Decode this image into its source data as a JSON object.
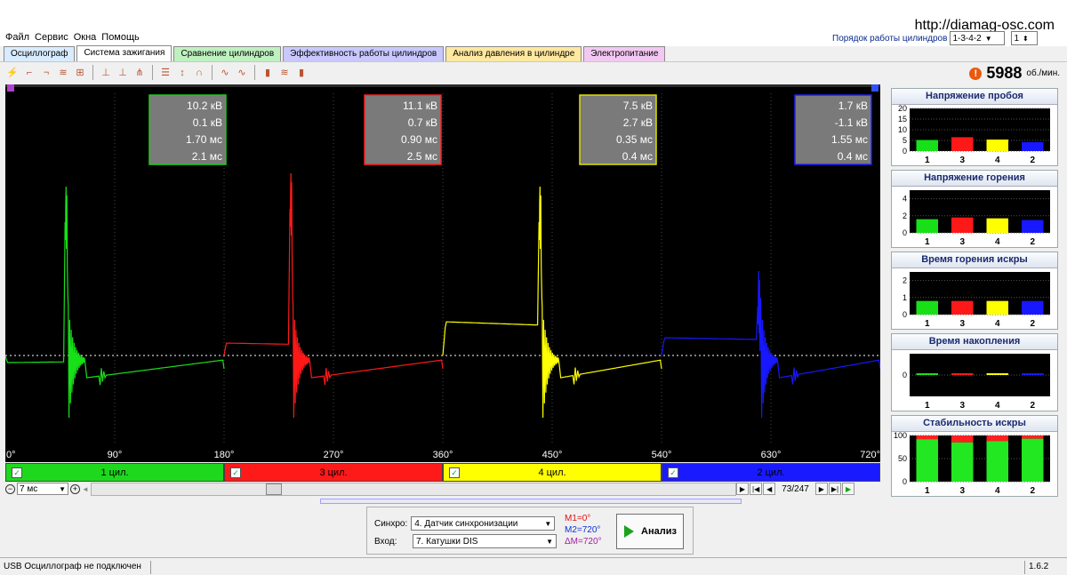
{
  "app": {
    "url": "http://diamag-osc.com",
    "menu": [
      "Файл",
      "Сервис",
      "Окна",
      "Помощь"
    ],
    "firing_order_label": "Порядок работы цилиндров",
    "firing_order_value": "1-3-4-2",
    "firing_order_index": "1"
  },
  "tabs": [
    {
      "label": "Осциллограф",
      "color": "#d8ecff",
      "active": false
    },
    {
      "label": "Система зажигания",
      "color": "#ffffff",
      "active": true
    },
    {
      "label": "Сравнение цилиндров",
      "color": "#bff0c0",
      "active": false
    },
    {
      "label": "Эффективность работы цилиндров",
      "color": "#c8c8ff",
      "active": false
    },
    {
      "label": "Анализ давления в цилиндре",
      "color": "#ffe8a0",
      "active": false
    },
    {
      "label": "Электропитание",
      "color": "#f2c8f2",
      "active": false
    }
  ],
  "toolbar": {
    "icons": [
      "spark-icon",
      "rise-icon",
      "fall-icon",
      "coil-icon",
      "counter-icon",
      "|",
      "pulse-icon",
      "multi-pulse-icon",
      "scatter-icon",
      "|",
      "lines-icon",
      "sync-icon",
      "loop-icon",
      "|",
      "wave-icon",
      "wave-split-icon",
      "|",
      "histogram-icon",
      "stack-icon",
      "bars-icon"
    ],
    "rpm_value": "5988",
    "rpm_unit": "об./мин."
  },
  "chart_data": {
    "type": "line",
    "xlabel": "",
    "ylabel": "",
    "x_ticks": [
      "0°",
      "90°",
      "180°",
      "270°",
      "360°",
      "450°",
      "540°",
      "630°",
      "720°"
    ],
    "xlim": [
      0,
      720
    ],
    "series": [
      {
        "name": "1 цил.",
        "color": "#18e018",
        "x_range": [
          0,
          180
        ],
        "spike_deg": 50
      },
      {
        "name": "3 цил.",
        "color": "#ff1818",
        "x_range": [
          180,
          360
        ],
        "spike_deg": 235
      },
      {
        "name": "4 цил.",
        "color": "#ffff00",
        "x_range": [
          360,
          540
        ],
        "spike_deg": 440
      },
      {
        "name": "2 цил.",
        "color": "#1818ff",
        "x_range": [
          540,
          720
        ],
        "spike_deg": 620
      }
    ],
    "info_boxes": [
      {
        "values": [
          "10.2 кВ",
          "0.1 кВ",
          "1.70 мс",
          "2.1 мс"
        ],
        "border": "#18d018"
      },
      {
        "values": [
          "11.1 кВ",
          "0.7 кВ",
          "0.90 мс",
          "2.5 мс"
        ],
        "border": "#ff2020"
      },
      {
        "values": [
          "7.5 кВ",
          "2.7 кВ",
          "0.35 мс",
          "0.4 мс"
        ],
        "border": "#e0e000"
      },
      {
        "values": [
          "1.7 кВ",
          "-1.1 кВ",
          "1.55 мс",
          "0.4 мс"
        ],
        "border": "#2020ff"
      }
    ]
  },
  "cylinders": [
    {
      "label": "1 цил.",
      "color": "#1ed81e",
      "text_color": "#000000"
    },
    {
      "label": "3 цил.",
      "color": "#ff1a1a",
      "text_color": "#000000"
    },
    {
      "label": "4 цил.",
      "color": "#ffff00",
      "text_color": "#000000"
    },
    {
      "label": "2 цил.",
      "color": "#1a1aff",
      "text_color": "#000000"
    }
  ],
  "scroll": {
    "zoom": "7 мс",
    "page": "73/247"
  },
  "control": {
    "sync_label": "Синхро:",
    "sync_value": "4. Датчик синхронизации",
    "input_label": "Вход:",
    "input_value": "7. Катушки DIS",
    "m1": "M1=0°",
    "m2": "M2=720°",
    "dm": "ΔM=720°",
    "analyze_button": "Анализ"
  },
  "status": {
    "left": "USB Осциллограф не подключен",
    "version": "1.6.2"
  },
  "mini_charts": [
    {
      "title": "Напряжение пробоя",
      "type": "bar",
      "categories": [
        "1",
        "3",
        "4",
        "2"
      ],
      "yticks": [
        "20",
        "15",
        "10",
        "5",
        "0"
      ],
      "ylim": [
        0,
        20
      ],
      "values": [
        5.2,
        6.5,
        5.4,
        4.2
      ]
    },
    {
      "title": "Напряжение горения",
      "type": "bar",
      "categories": [
        "1",
        "3",
        "4",
        "2"
      ],
      "yticks": [
        "4",
        "2",
        "0"
      ],
      "ylim": [
        0,
        5
      ],
      "values": [
        1.6,
        1.8,
        1.7,
        1.5
      ]
    },
    {
      "title": "Время горения искры",
      "type": "bar",
      "categories": [
        "1",
        "3",
        "4",
        "2"
      ],
      "yticks": [
        "2",
        "1",
        "0"
      ],
      "ylim": [
        0,
        2.5
      ],
      "values": [
        0.8,
        0.8,
        0.8,
        0.8
      ]
    },
    {
      "title": "Время накопления",
      "type": "bar",
      "categories": [
        "1",
        "3",
        "4",
        "2"
      ],
      "yticks": [
        "0"
      ],
      "ylim": [
        -1,
        1
      ],
      "values": [
        0.05,
        0.05,
        0.05,
        0.05
      ]
    },
    {
      "title": "Стабильность искры",
      "type": "stacked",
      "categories": [
        "1",
        "3",
        "4",
        "2"
      ],
      "yticks": [
        "100",
        "50",
        "0"
      ],
      "ylim": [
        0,
        100
      ],
      "values": [
        92,
        85,
        88,
        93
      ]
    }
  ]
}
